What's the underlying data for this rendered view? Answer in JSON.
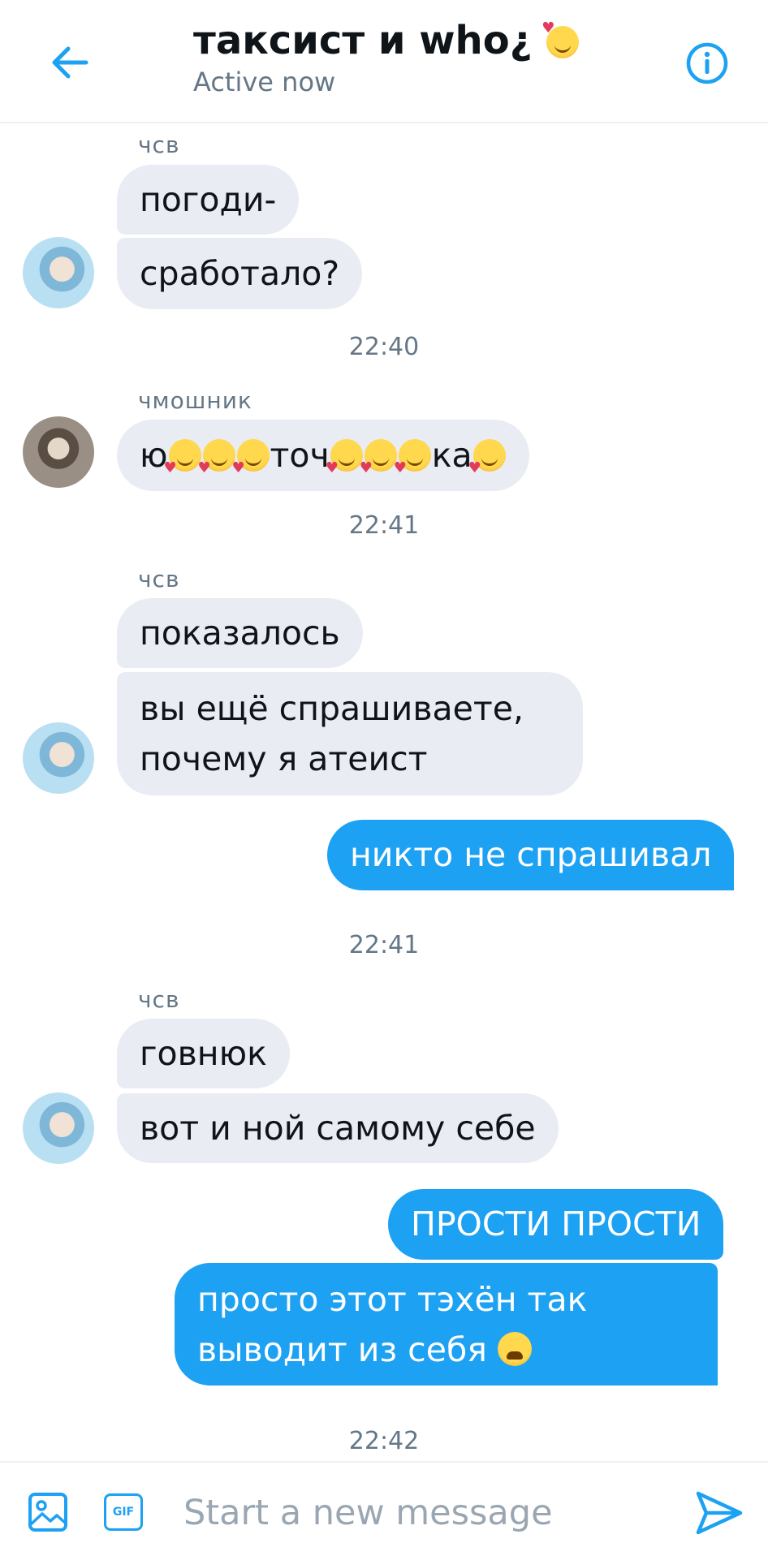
{
  "header": {
    "title": "таксист и who¿",
    "status": "Active now"
  },
  "messages": {
    "g1_sender": "чсв",
    "g1_m1": "погоди-",
    "g1_m2": "сработало?",
    "t1": "22:40",
    "g2_sender": "чмошник",
    "g2_m1_parts": [
      "ю",
      "",
      "",
      "точ",
      "",
      "",
      "ка",
      ""
    ],
    "t2": "22:41",
    "g3_sender": "чсв",
    "g3_m1": "показалось",
    "g3_m2": "вы ещё спрашиваете, почему я атеист",
    "o1": "никто не спрашивал",
    "t3": "22:41",
    "g4_sender": "чсв",
    "g4_m1": "говнюк",
    "g4_m2": "вот и ной самому себе",
    "o2": "ПРОСТИ ПРОСТИ",
    "o3": "просто этот тэхён так выводит из себя",
    "t4": "22:42"
  },
  "composer": {
    "placeholder": "Start a new message",
    "gif_label": "GIF"
  },
  "colors": {
    "accent": "#1da1f2",
    "incoming_bubble": "#e9ecf3",
    "muted_text": "#657786"
  },
  "icons": [
    "back-arrow-icon",
    "info-icon",
    "heart-smile-emoji-icon",
    "weary-emoji-icon",
    "image-icon",
    "gif-icon",
    "send-icon"
  ]
}
